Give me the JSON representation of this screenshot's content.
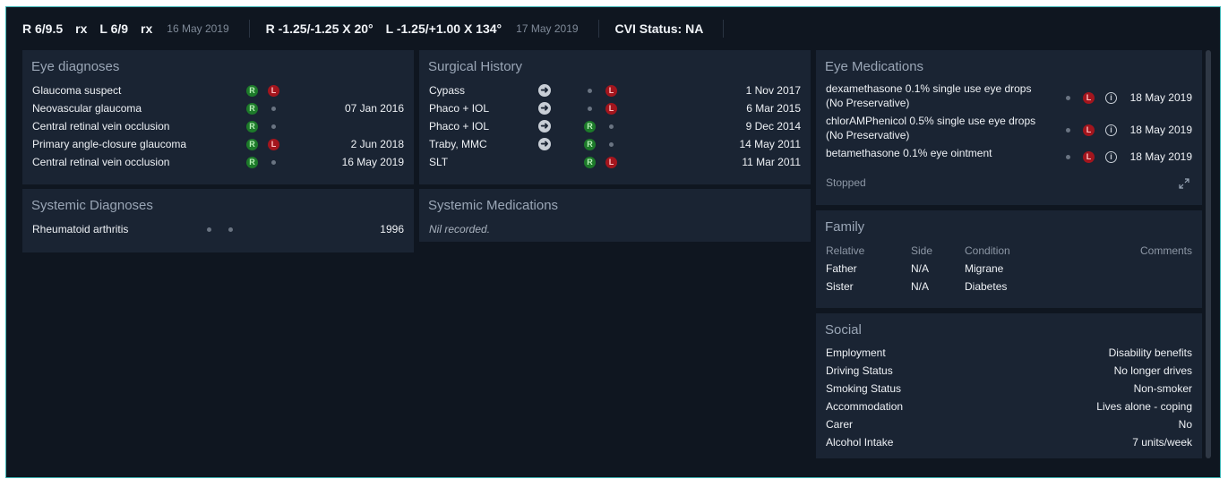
{
  "topbar": {
    "va": {
      "right": "R 6/9.5",
      "right_rx": "rx",
      "left": "L 6/9",
      "left_rx": "rx",
      "date": "16 May 2019"
    },
    "refraction": {
      "right": "R -1.25/-1.25 X 20°",
      "left": "L -1.25/+1.00 X 134°",
      "date": "17 May 2019"
    },
    "cvi": "CVI Status: NA"
  },
  "eye_diagnoses": {
    "title": "Eye diagnoses",
    "rows": [
      {
        "name": "Glaucoma suspect",
        "r": true,
        "l": true,
        "date": ""
      },
      {
        "name": "Neovascular glaucoma",
        "r": true,
        "l": false,
        "date": "07 Jan 2016"
      },
      {
        "name": "Central retinal vein occlusion",
        "r": true,
        "l": false,
        "date": ""
      },
      {
        "name": "Primary angle-closure glaucoma",
        "r": true,
        "l": true,
        "date": "2 Jun 2018"
      },
      {
        "name": "Central retinal vein occlusion",
        "r": true,
        "l": false,
        "date": "16 May 2019"
      }
    ]
  },
  "surgical_history": {
    "title": "Surgical History",
    "rows": [
      {
        "name": "Cypass",
        "r": false,
        "l": true,
        "date": "1 Nov 2017"
      },
      {
        "name": "Phaco + IOL",
        "r": false,
        "l": true,
        "date": "6 Mar 2015"
      },
      {
        "name": "Phaco + IOL",
        "r": true,
        "l": false,
        "date": "9 Dec 2014"
      },
      {
        "name": "Traby, MMC",
        "r": true,
        "l": false,
        "date": "14 May 2011"
      },
      {
        "name": "SLT",
        "r": true,
        "l": true,
        "date": "11 Mar 2011",
        "no_arrow": true
      }
    ]
  },
  "eye_medications": {
    "title": "Eye Medications",
    "rows": [
      {
        "name": "dexamethasone 0.1% single use eye drops",
        "name2": "(No Preservative)",
        "date": "18 May 2019"
      },
      {
        "name": "chlorAMPhenicol 0.5% single use eye drops",
        "name2": "(No Preservative)",
        "date": "18 May 2019"
      },
      {
        "name": "betamethasone 0.1% eye ointment",
        "name2": "",
        "date": "18 May 2019"
      }
    ],
    "stopped": "Stopped"
  },
  "systemic_diagnoses": {
    "title": "Systemic Diagnoses",
    "rows": [
      {
        "name": "Rheumatoid arthritis",
        "date": "1996"
      }
    ]
  },
  "systemic_medications": {
    "title": "Systemic Medications",
    "empty": "Nil recorded."
  },
  "family": {
    "title": "Family",
    "headers": {
      "relative": "Relative",
      "side": "Side",
      "condition": "Condition",
      "comments": "Comments"
    },
    "rows": [
      {
        "relative": "Father",
        "side": "N/A",
        "condition": "Migrane"
      },
      {
        "relative": "Sister",
        "side": "N/A",
        "condition": "Diabetes"
      }
    ]
  },
  "social": {
    "title": "Social",
    "rows": [
      {
        "label": "Employment",
        "value": "Disability benefits"
      },
      {
        "label": "Driving Status",
        "value": "No longer drives"
      },
      {
        "label": "Smoking Status",
        "value": "Non-smoker"
      },
      {
        "label": "Accommodation",
        "value": "Lives alone - coping"
      },
      {
        "label": "Carer",
        "value": "No"
      },
      {
        "label": "Alcohol Intake",
        "value": "7 units/week"
      }
    ]
  },
  "badges": {
    "r": "R",
    "l": "L"
  },
  "colors": {
    "accent": "#3fb5b5",
    "right_eye": "#1d7a2a",
    "left_eye": "#a3151d",
    "panel": "#1a2433",
    "background": "#0f1620"
  }
}
